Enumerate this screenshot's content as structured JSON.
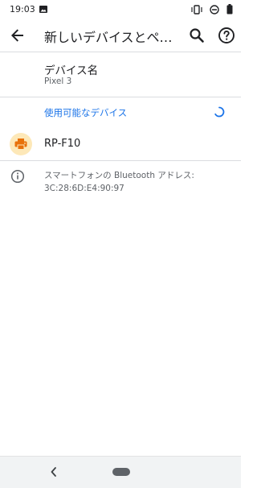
{
  "status_bar": {
    "time": "19:03",
    "left_icons": [
      "photo-icon"
    ],
    "right_icons": [
      "vibrate-icon",
      "do-not-disturb-icon",
      "battery-icon"
    ]
  },
  "app_bar": {
    "title": "新しいデバイスとペア…",
    "back_icon": "arrow-back-icon",
    "search_icon": "search-icon",
    "help_icon": "help-icon"
  },
  "device_name": {
    "title": "デバイス名",
    "value": "Pixel 3"
  },
  "available_devices": {
    "header": "使用可能なデバイス",
    "spinner_icon": "progress-spinner-icon",
    "items": [
      {
        "icon": "printer-icon",
        "label": "RP-F10"
      }
    ]
  },
  "bluetooth_info": {
    "icon": "info-icon",
    "text": "スマートフォンの Bluetooth アドレス: 3C:28:6D:E4:90:97"
  },
  "nav_bar": {
    "back_icon": "nav-back-icon",
    "home_icon": "home-pill-icon"
  },
  "colors": {
    "accent": "#1a73e8",
    "printer_badge_bg": "#fde8b8",
    "printer_icon": "#e8710a",
    "secondary_text": "#5f6368",
    "divider": "#dadce0"
  }
}
